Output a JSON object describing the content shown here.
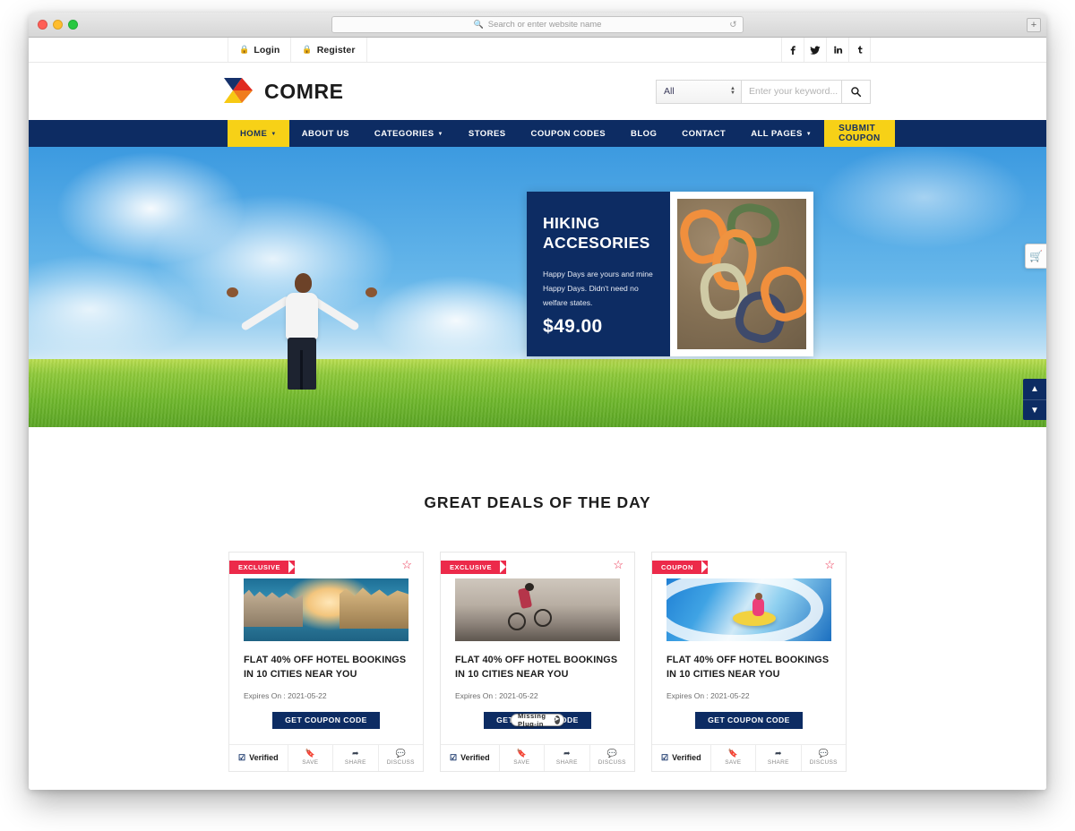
{
  "browser": {
    "url_placeholder": "Search or enter website name",
    "search_icon": "search-icon",
    "reload_icon": "reload-icon",
    "new_tab_icon": "plus-icon"
  },
  "topbar": {
    "links": [
      {
        "label": "Login",
        "icon": "lock-icon"
      },
      {
        "label": "Register",
        "icon": "lock-icon"
      }
    ],
    "social": [
      {
        "name": "facebook-icon",
        "glyph": "f"
      },
      {
        "name": "twitter-icon",
        "glyph": "t"
      },
      {
        "name": "linkedin-icon",
        "glyph": "in"
      },
      {
        "name": "tumblr-icon",
        "glyph": "t"
      }
    ]
  },
  "header": {
    "brand_name": "COMRE",
    "logo_colors": {
      "navy": "#16316b",
      "red": "#e02b20",
      "orange": "#f07c1c",
      "yellow": "#f7c913"
    },
    "search": {
      "category_selected": "All",
      "placeholder": "Enter your keyword...",
      "button_icon": "search-icon"
    }
  },
  "nav": {
    "items": [
      {
        "label": "HOME",
        "caret": true,
        "active": true
      },
      {
        "label": "ABOUT US",
        "caret": false,
        "active": false
      },
      {
        "label": "CATEGORIES",
        "caret": true,
        "active": false
      },
      {
        "label": "STORES",
        "caret": false,
        "active": false
      },
      {
        "label": "COUPON CODES",
        "caret": false,
        "active": false
      },
      {
        "label": "BLOG",
        "caret": false,
        "active": false
      },
      {
        "label": "CONTACT",
        "caret": false,
        "active": false
      },
      {
        "label": "ALL PAGES",
        "caret": true,
        "active": false
      }
    ],
    "cta_label": "SUBMIT COUPON",
    "bg_color": "#0d2c63",
    "accent_color": "#f7d117"
  },
  "hero": {
    "promo": {
      "title_line1": "HIKING",
      "title_line2": "ACCESORIES",
      "description": "Happy Days are yours and mine Happy Days. Didn't need no welfare states.",
      "price": "$49.00",
      "image_alt": "carabiner-clips-photo"
    },
    "cart_icon": "shopping-cart-icon",
    "slider_prev_icon": "chevron-up-icon",
    "slider_next_icon": "chevron-down-icon"
  },
  "deals": {
    "section_title": "GREAT DEALS OF THE DAY",
    "cards": [
      {
        "ribbon": "EXCLUSIVE",
        "favorite_icon": "star-outline-icon",
        "image": "venice-canal-photo",
        "title": "FLAT 40% OFF HOTEL BOOKINGS IN 10 CITIES NEAR YOU",
        "expires": "Expires On : 2021-05-22",
        "button_label": "GET COUPON CODE",
        "plugin_overlay": null,
        "footer": {
          "verified_label": "Verified",
          "actions": [
            {
              "label": "SAVE",
              "icon": "bookmark-icon"
            },
            {
              "label": "SHARE",
              "icon": "share-arrow-icon"
            },
            {
              "label": "DISCUSS",
              "icon": "comment-icon"
            }
          ]
        }
      },
      {
        "ribbon": "EXCLUSIVE",
        "favorite_icon": "star-outline-icon",
        "image": "mountain-biker-photo",
        "title": "FLAT 40% OFF HOTEL BOOKINGS IN 10 CITIES NEAR YOU",
        "expires": "Expires On : 2021-05-22",
        "button_label": "GET COUPON CODE",
        "plugin_overlay": "Missing Plug-in",
        "footer": {
          "verified_label": "Verified",
          "actions": [
            {
              "label": "SAVE",
              "icon": "bookmark-icon"
            },
            {
              "label": "SHARE",
              "icon": "share-arrow-icon"
            },
            {
              "label": "DISCUSS",
              "icon": "comment-icon"
            }
          ]
        }
      },
      {
        "ribbon": "COUPON",
        "favorite_icon": "star-outline-icon",
        "image": "water-slide-photo",
        "title": "FLAT 40% OFF HOTEL BOOKINGS IN 10 CITIES NEAR YOU",
        "expires": "Expires On : 2021-05-22",
        "button_label": "GET COUPON CODE",
        "plugin_overlay": null,
        "footer": {
          "verified_label": "Verified",
          "actions": [
            {
              "label": "SAVE",
              "icon": "bookmark-icon"
            },
            {
              "label": "SHARE",
              "icon": "share-arrow-icon"
            },
            {
              "label": "DISCUSS",
              "icon": "comment-icon"
            }
          ]
        }
      }
    ]
  }
}
